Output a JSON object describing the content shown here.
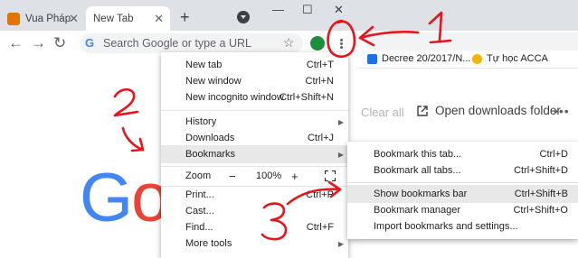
{
  "tabs": [
    {
      "title": "Vua Pháp",
      "active": false
    },
    {
      "title": "New Tab",
      "active": true
    }
  ],
  "window_controls": {
    "minimize": "—",
    "maximize": "☐",
    "close": "✕"
  },
  "omnibox": {
    "placeholder": "Search Google or type a URL"
  },
  "google_logo": {
    "g1": "G",
    "o1": "o"
  },
  "background_window": {
    "bookmarks_bar": [
      {
        "label": "Decree 20/2017/N...",
        "icon": "bookmark-favicon"
      },
      {
        "label": "Tự học ACCA",
        "icon": "emoji-favicon"
      }
    ],
    "clear_all": "Clear all",
    "open_downloads": "Open downloads folder",
    "more": "⋮"
  },
  "menu": {
    "new_tab": {
      "label": "New tab",
      "shortcut": "Ctrl+T"
    },
    "new_window": {
      "label": "New window",
      "shortcut": "Ctrl+N"
    },
    "new_incognito": {
      "label": "New incognito window",
      "shortcut": "Ctrl+Shift+N"
    },
    "history": {
      "label": "History"
    },
    "downloads": {
      "label": "Downloads",
      "shortcut": "Ctrl+J"
    },
    "bookmarks": {
      "label": "Bookmarks"
    },
    "zoom": {
      "label": "Zoom",
      "minus": "−",
      "value": "100%",
      "plus": "+"
    },
    "print": {
      "label": "Print...",
      "shortcut": "Ctrl+P"
    },
    "cast": {
      "label": "Cast..."
    },
    "find": {
      "label": "Find...",
      "shortcut": "Ctrl+F"
    },
    "more_tools": {
      "label": "More tools"
    }
  },
  "bookmarks_submenu": [
    {
      "label": "Bookmark this tab...",
      "shortcut": "Ctrl+D",
      "highlight": false
    },
    {
      "label": "Bookmark all tabs...",
      "shortcut": "Ctrl+Shift+D",
      "highlight": false
    },
    {
      "label": "Show bookmarks bar",
      "shortcut": "Ctrl+Shift+B",
      "highlight": true
    },
    {
      "label": "Bookmark manager",
      "shortcut": "Ctrl+Shift+O",
      "highlight": false
    },
    {
      "label": "Import bookmarks and settings...",
      "shortcut": "",
      "highlight": false
    }
  ],
  "annotations": {
    "step1": "1",
    "step2": "2",
    "step3": "3",
    "color": "#e8141a"
  },
  "colors": {
    "annotation": "#e8141a",
    "highlight": "#e8e8e8",
    "tabstrip": "#dee1e6"
  }
}
